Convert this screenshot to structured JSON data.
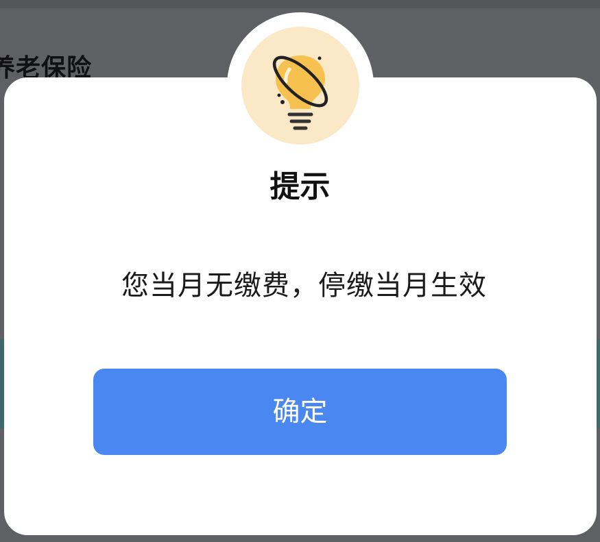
{
  "background": {
    "heading": "养老保险"
  },
  "dialog": {
    "icon": "lightbulb-icon",
    "title": "提示",
    "message": "您当月无缴费，停缴当月生效",
    "confirm_label": "确定"
  },
  "colors": {
    "overlay": "#5f6063",
    "dialog_bg": "#ffffff",
    "icon_bg": "#fbe8c7",
    "bulb": "#f6c14e",
    "primary_button": "#4a87f0",
    "button_text": "#ffffff",
    "title_text": "#111111"
  }
}
